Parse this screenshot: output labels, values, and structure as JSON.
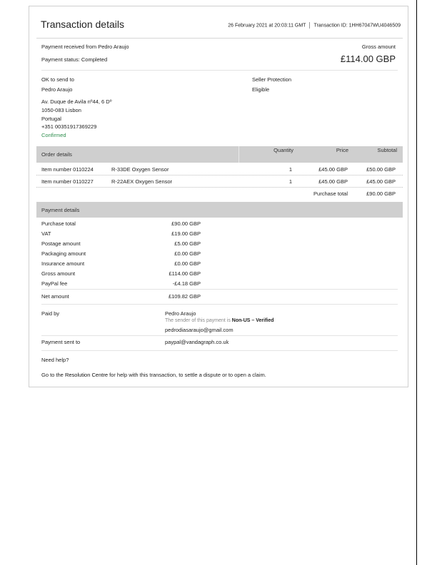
{
  "header": {
    "title": "Transaction details",
    "datetime": "26 February 2021 at 20:03:11 GMT",
    "transaction_id": "Transaction ID: 1HH67047WU4046509"
  },
  "summary": {
    "received_from": "Payment received from Pedro Araujo",
    "status_label": "Payment status:",
    "status_value": "Completed",
    "gross_label": "Gross amount",
    "gross_value": "£114.00 GBP"
  },
  "shipping": {
    "ok_label": "OK to send to",
    "name": "Pedro Araujo",
    "address_lines": [
      "Av. Duque de Avila nº44, 6 Dº",
      "1050-083 Lisbon",
      "Portugal",
      "+351 00351917369229"
    ],
    "status": "Confirmed",
    "protection_label": "Seller Protection",
    "protection_value": "Eligible"
  },
  "order": {
    "header": "Order details",
    "columns": [
      "Quantity",
      "Price",
      "Subtotal"
    ],
    "items": [
      {
        "number": "Item number 0110224",
        "desc": "R-33DE Oxygen Sensor",
        "qty": "1",
        "price": "£45.00 GBP",
        "subtotal": "£50.00 GBP"
      },
      {
        "number": "Item number 0110227",
        "desc": "R-22AEX Oxygen Sensor",
        "qty": "1",
        "price": "£45.00 GBP",
        "subtotal": "£45.00 GBP"
      }
    ],
    "total_label": "Purchase total",
    "total_value": "£90.00 GBP"
  },
  "payment": {
    "header": "Payment details",
    "rows": [
      {
        "label": "Purchase total",
        "value": "£90.00 GBP"
      },
      {
        "label": "VAT",
        "value": "£19.00 GBP"
      },
      {
        "label": "Postage amount",
        "value": "£5.00 GBP"
      },
      {
        "label": "Packaging amount",
        "value": "£0.00 GBP"
      },
      {
        "label": "Insurance amount",
        "value": "£0.00 GBP"
      },
      {
        "label": "Gross amount",
        "value": "£114.00 GBP"
      },
      {
        "label": "PayPal fee",
        "value": "-£4.18 GBP"
      }
    ],
    "net_label": "Net amount",
    "net_value": "£109.82 GBP"
  },
  "paid_by": {
    "label": "Paid by",
    "name": "Pedro Araujo",
    "verified_prefix": "The sender of this payment is",
    "verified_value": "Non-US – Verified",
    "email": "pedrodiasaraujo@gmail.com"
  },
  "sent_to": {
    "label": "Payment sent to",
    "email": "paypal@vandagraph.co.uk"
  },
  "help": {
    "title": "Need help?",
    "text_prefix": "Go to the",
    "link": "Resolution Centre",
    "text_suffix": "for help with this transaction, to settle a dispute or to open a claim."
  }
}
